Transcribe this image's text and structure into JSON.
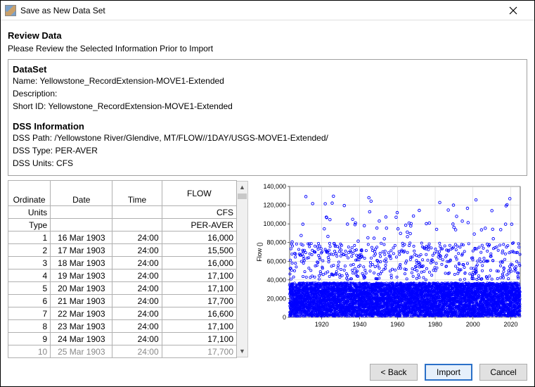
{
  "window": {
    "title": "Save as New Data Set"
  },
  "header": {
    "title": "Review Data",
    "subtitle": "Please Review the Selected Information Prior to Import"
  },
  "dataset": {
    "heading": "DataSet",
    "name_label": "Name:",
    "name": "Yellowstone_RecordExtension-MOVE1-Extended",
    "description_label": "Description:",
    "description": "",
    "shortid_label": "Short ID:",
    "shortid": "Yellowstone_RecordExtension-MOVE1-Extended"
  },
  "dss": {
    "heading": "DSS Information",
    "path_label": "DSS Path:",
    "path": "/Yellowstone River/Glendive, MT/FLOW//1DAY/USGS-MOVE1-Extended/",
    "type_label": "DSS Type:",
    "type": "PER-AVER",
    "units_label": "DSS Units:",
    "units": "CFS"
  },
  "table": {
    "headers": {
      "ordinate": "Ordinate",
      "date": "Date",
      "time": "Time",
      "flow": "FLOW"
    },
    "units_label": "Units",
    "type_label": "Type",
    "flow_units": "CFS",
    "flow_type": "PER-AVER",
    "rows": [
      {
        "n": "1",
        "date": "16 Mar 1903",
        "time": "24:00",
        "flow": "16,000"
      },
      {
        "n": "2",
        "date": "17 Mar 1903",
        "time": "24:00",
        "flow": "15,500"
      },
      {
        "n": "3",
        "date": "18 Mar 1903",
        "time": "24:00",
        "flow": "16,000"
      },
      {
        "n": "4",
        "date": "19 Mar 1903",
        "time": "24:00",
        "flow": "17,100"
      },
      {
        "n": "5",
        "date": "20 Mar 1903",
        "time": "24:00",
        "flow": "17,100"
      },
      {
        "n": "6",
        "date": "21 Mar 1903",
        "time": "24:00",
        "flow": "17,700"
      },
      {
        "n": "7",
        "date": "22 Mar 1903",
        "time": "24:00",
        "flow": "16,600"
      },
      {
        "n": "8",
        "date": "23 Mar 1903",
        "time": "24:00",
        "flow": "17,100"
      },
      {
        "n": "9",
        "date": "24 Mar 1903",
        "time": "24:00",
        "flow": "17,100"
      },
      {
        "n": "10",
        "date": "25 Mar 1903",
        "time": "24:00",
        "flow": "17,700"
      }
    ]
  },
  "chart_data": {
    "type": "scatter",
    "title": "",
    "xlabel": "",
    "ylabel": "Flow ()",
    "x_range": [
      1903,
      2025
    ],
    "y_range": [
      0,
      140000
    ],
    "x_ticks": [
      1920,
      1940,
      1960,
      1980,
      2000,
      2020
    ],
    "y_ticks": [
      0,
      20000,
      40000,
      60000,
      80000,
      100000,
      120000,
      140000
    ],
    "y_tick_labels": [
      "0",
      "20,000",
      "40,000",
      "60,000",
      "80,000",
      "100,000",
      "120,000",
      "140,000"
    ],
    "dense_band_note": "dense scatter of daily flow values; majority under 40,000 with sporadic peaks up to ~130,000",
    "sample_points_for_shape": {
      "dense_top": 40000,
      "typical_mid": 15000
    }
  },
  "buttons": {
    "back": "< Back",
    "import": "Import",
    "cancel": "Cancel"
  }
}
